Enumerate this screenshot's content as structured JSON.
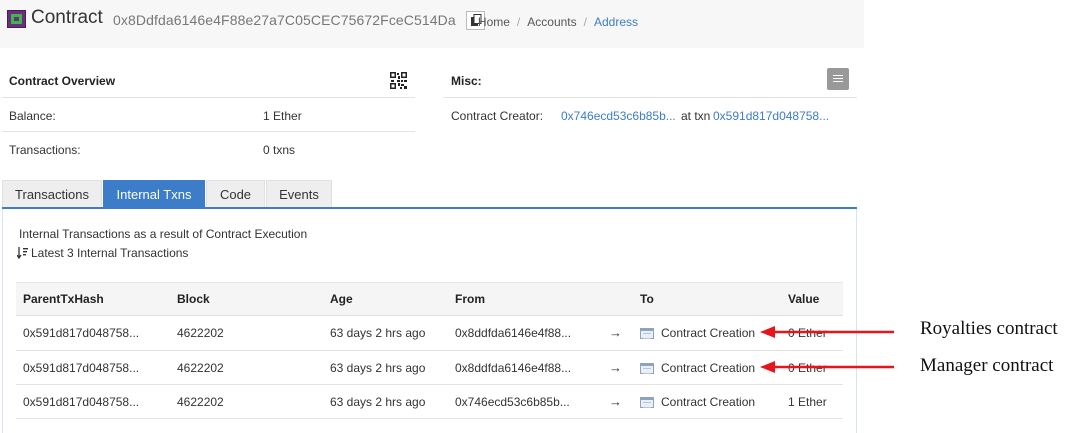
{
  "header": {
    "title": "Contract",
    "address": "0x8Ddfda6146e4F88e27a7C05CEC75672FceC514Da",
    "breadcrumb": [
      "Home",
      "Accounts",
      "Address"
    ]
  },
  "overview": {
    "title": "Contract Overview",
    "balance_label": "Balance:",
    "balance_value": "1 Ether",
    "txns_label": "Transactions:",
    "txns_value": "0 txns"
  },
  "misc": {
    "title": "Misc:",
    "creator_label": "Contract Creator:",
    "creator_address": "0x746ecd53c6b85b...",
    "at_txn_label": "at txn",
    "creator_txn": "0x591d817d048758..."
  },
  "tabs": [
    "Transactions",
    "Internal Txns",
    "Code",
    "Events"
  ],
  "active_tab": "Internal Txns",
  "internal_txns": {
    "description": "Internal Transactions as a result of Contract Execution",
    "subtitle": "Latest 3 Internal Transactions",
    "columns": [
      "ParentTxHash",
      "Block",
      "Age",
      "From",
      "To",
      "Value"
    ],
    "rows": [
      {
        "parent": "0x591d817d048758...",
        "block": "4622202",
        "age": "63 days 2 hrs ago",
        "from": "0x8ddfda6146e4f88...",
        "from_is_link": false,
        "to": "Contract Creation",
        "to_is_link": true,
        "value": "0 Ether"
      },
      {
        "parent": "0x591d817d048758...",
        "block": "4622202",
        "age": "63 days 2 hrs ago",
        "from": "0x8ddfda6146e4f88...",
        "from_is_link": false,
        "to": "Contract Creation",
        "to_is_link": true,
        "value": "0 Ether"
      },
      {
        "parent": "0x591d817d048758...",
        "block": "4622202",
        "age": "63 days 2 hrs ago",
        "from": "0x746ecd53c6b85b...",
        "from_is_link": true,
        "to": "Contract Creation",
        "to_is_link": false,
        "value": "1 Ether"
      }
    ]
  },
  "annotations": [
    "Royalties contract",
    "Manager contract"
  ],
  "colors": {
    "link": "#3d7cc9",
    "active_tab": "#3d7cc9",
    "annotation_arrow": "#e8141b"
  },
  "icons": [
    "contract-logo-icon",
    "copy-icon",
    "qr-code-icon",
    "misc-menu-icon",
    "sort-icon",
    "right-arrow-icon",
    "contract-creation-icon",
    "annotation-arrow-icon"
  ]
}
